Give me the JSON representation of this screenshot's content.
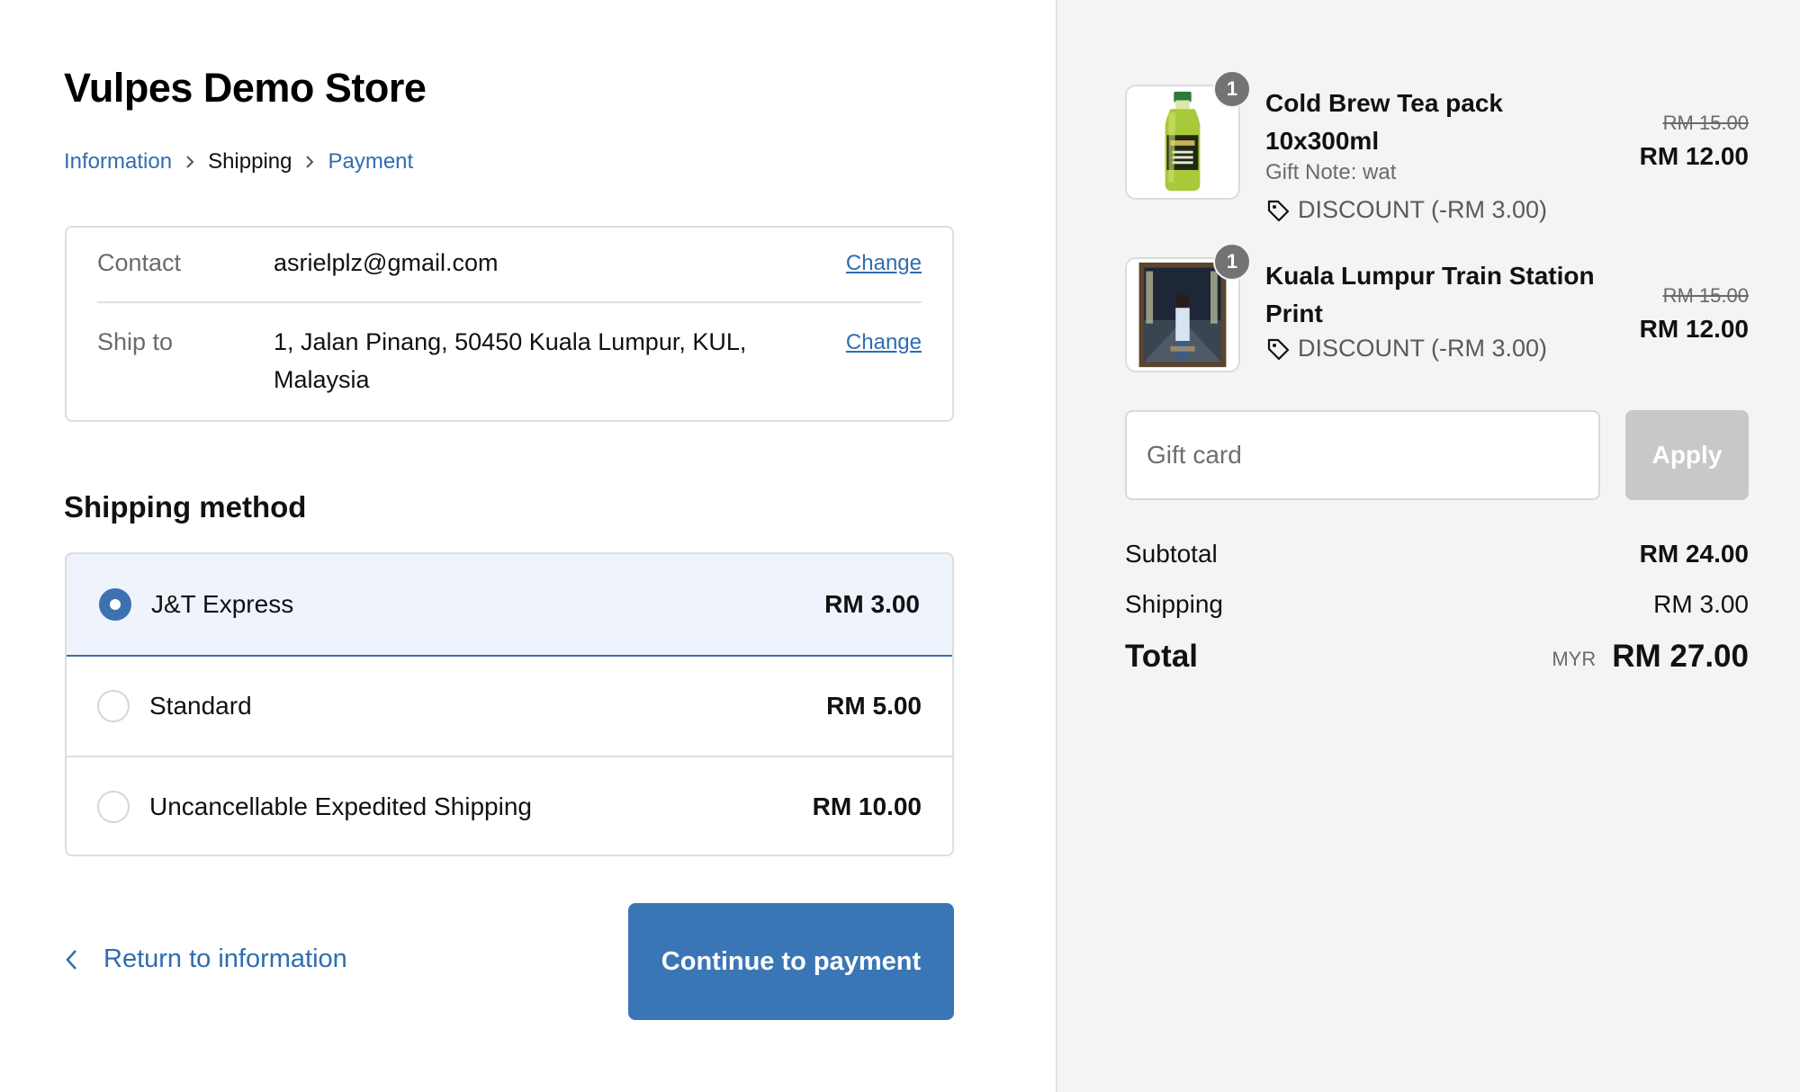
{
  "store": {
    "title": "Vulpes Demo Store"
  },
  "breadcrumb": {
    "information": "Information",
    "shipping": "Shipping",
    "payment": "Payment"
  },
  "review": {
    "contact_label": "Contact",
    "contact_value": "asrielplz@gmail.com",
    "ship_label": "Ship to",
    "ship_value": "1, Jalan Pinang, 50450 Kuala Lumpur, KUL, Malaysia",
    "change_label": "Change"
  },
  "shipping_method": {
    "title": "Shipping method",
    "options": [
      {
        "name": "J&T Express",
        "price": "RM 3.00",
        "selected": true
      },
      {
        "name": "Standard",
        "price": "RM 5.00",
        "selected": false
      },
      {
        "name": "Uncancellable Expedited Shipping",
        "price": "RM 10.00",
        "selected": false
      }
    ]
  },
  "footer": {
    "return_label": "Return to information",
    "continue_label": "Continue to payment"
  },
  "cart": {
    "items": [
      {
        "name": "Cold Brew Tea pack 10x300ml",
        "quantity": "1",
        "note": "Gift Note: wat",
        "discount": "DISCOUNT (-RM 3.00)",
        "original_price": "RM 15.00",
        "price": "RM 12.00",
        "image_icon": "tea-bottle-image"
      },
      {
        "name": "Kuala Lumpur Train Station Print",
        "quantity": "1",
        "discount": "DISCOUNT (-RM 3.00)",
        "original_price": "RM 15.00",
        "price": "RM 12.00",
        "image_icon": "framed-print-image"
      }
    ],
    "gift_card_placeholder": "Gift card",
    "apply_label": "Apply",
    "subtotal_label": "Subtotal",
    "subtotal_value": "RM 24.00",
    "shipping_label": "Shipping",
    "shipping_value": "RM 3.00",
    "total_label": "Total",
    "currency": "MYR",
    "total_value": "RM 27.00"
  },
  "colors": {
    "accent": "#3a76b6",
    "link": "#2f6db0",
    "selected_bg": "#eef3fc",
    "sidebar_bg": "#f4f4f4"
  }
}
